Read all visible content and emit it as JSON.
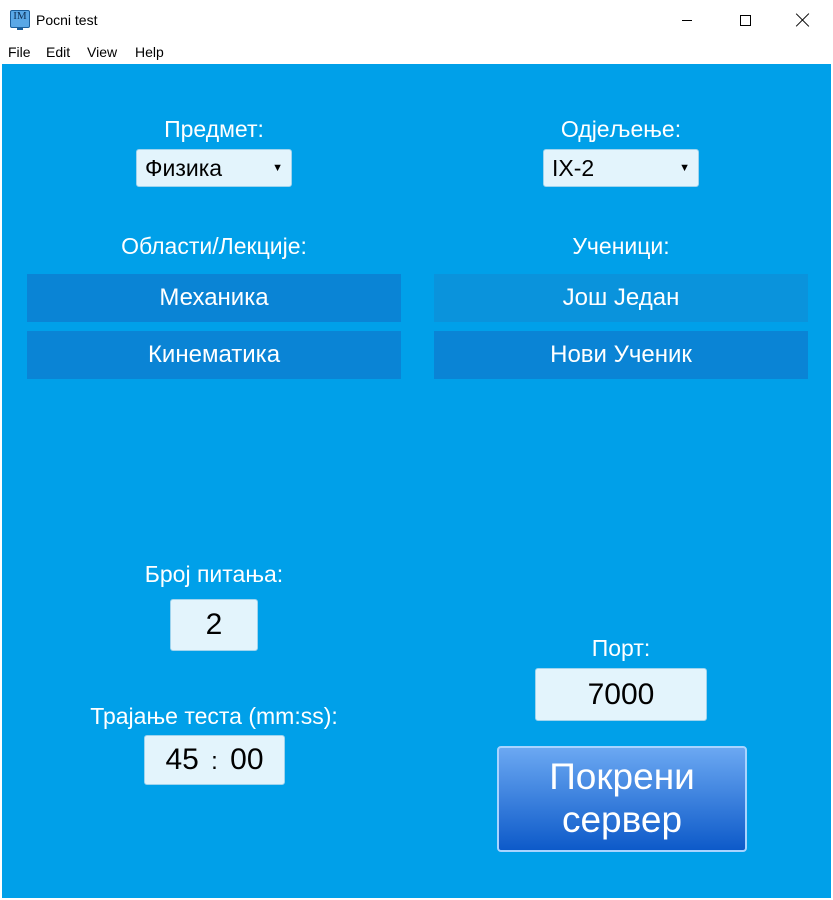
{
  "window": {
    "title": "Pocni test",
    "icon": "im-monitor-icon"
  },
  "menu": [
    "File",
    "Edit",
    "View",
    "Help"
  ],
  "subject": {
    "label": "Предмет:",
    "selected": "Физика"
  },
  "class": {
    "label": "Одјељење:",
    "selected": "IX-2"
  },
  "topics": {
    "label": "Области/Лекције:",
    "items": [
      "Механика",
      "Кинематика"
    ]
  },
  "students": {
    "label": "Ученици:",
    "items": [
      "Још Један",
      "Нови Ученик"
    ]
  },
  "question_count": {
    "label": "Број питања:",
    "value": "2"
  },
  "duration": {
    "label": "Трајање теста (mm:ss):",
    "minutes": "45",
    "separator": ":",
    "seconds": "00"
  },
  "port": {
    "label": "Порт:",
    "value": "7000"
  },
  "start_button": {
    "line1": "Покрени",
    "line2": "сервер"
  },
  "colors": {
    "background": "#00a0e9",
    "list_dark": "#0a84d5",
    "list_light": "#0a93dc",
    "button_top": "#6ba8f2",
    "button_bottom": "#0d5ac9"
  }
}
